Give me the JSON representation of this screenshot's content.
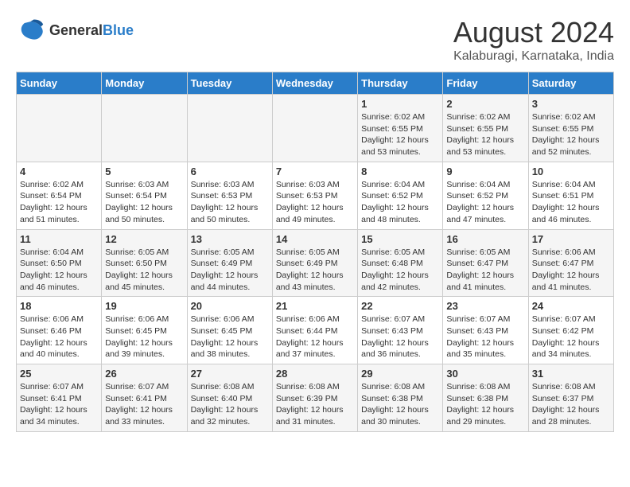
{
  "header": {
    "logo_line1": "General",
    "logo_line2": "Blue",
    "title": "August 2024",
    "subtitle": "Kalaburagi, Karnataka, India"
  },
  "weekdays": [
    "Sunday",
    "Monday",
    "Tuesday",
    "Wednesday",
    "Thursday",
    "Friday",
    "Saturday"
  ],
  "weeks": [
    [
      {
        "day": "",
        "detail": ""
      },
      {
        "day": "",
        "detail": ""
      },
      {
        "day": "",
        "detail": ""
      },
      {
        "day": "",
        "detail": ""
      },
      {
        "day": "1",
        "detail": "Sunrise: 6:02 AM\nSunset: 6:55 PM\nDaylight: 12 hours\nand 53 minutes."
      },
      {
        "day": "2",
        "detail": "Sunrise: 6:02 AM\nSunset: 6:55 PM\nDaylight: 12 hours\nand 53 minutes."
      },
      {
        "day": "3",
        "detail": "Sunrise: 6:02 AM\nSunset: 6:55 PM\nDaylight: 12 hours\nand 52 minutes."
      }
    ],
    [
      {
        "day": "4",
        "detail": "Sunrise: 6:02 AM\nSunset: 6:54 PM\nDaylight: 12 hours\nand 51 minutes."
      },
      {
        "day": "5",
        "detail": "Sunrise: 6:03 AM\nSunset: 6:54 PM\nDaylight: 12 hours\nand 50 minutes."
      },
      {
        "day": "6",
        "detail": "Sunrise: 6:03 AM\nSunset: 6:53 PM\nDaylight: 12 hours\nand 50 minutes."
      },
      {
        "day": "7",
        "detail": "Sunrise: 6:03 AM\nSunset: 6:53 PM\nDaylight: 12 hours\nand 49 minutes."
      },
      {
        "day": "8",
        "detail": "Sunrise: 6:04 AM\nSunset: 6:52 PM\nDaylight: 12 hours\nand 48 minutes."
      },
      {
        "day": "9",
        "detail": "Sunrise: 6:04 AM\nSunset: 6:52 PM\nDaylight: 12 hours\nand 47 minutes."
      },
      {
        "day": "10",
        "detail": "Sunrise: 6:04 AM\nSunset: 6:51 PM\nDaylight: 12 hours\nand 46 minutes."
      }
    ],
    [
      {
        "day": "11",
        "detail": "Sunrise: 6:04 AM\nSunset: 6:50 PM\nDaylight: 12 hours\nand 46 minutes."
      },
      {
        "day": "12",
        "detail": "Sunrise: 6:05 AM\nSunset: 6:50 PM\nDaylight: 12 hours\nand 45 minutes."
      },
      {
        "day": "13",
        "detail": "Sunrise: 6:05 AM\nSunset: 6:49 PM\nDaylight: 12 hours\nand 44 minutes."
      },
      {
        "day": "14",
        "detail": "Sunrise: 6:05 AM\nSunset: 6:49 PM\nDaylight: 12 hours\nand 43 minutes."
      },
      {
        "day": "15",
        "detail": "Sunrise: 6:05 AM\nSunset: 6:48 PM\nDaylight: 12 hours\nand 42 minutes."
      },
      {
        "day": "16",
        "detail": "Sunrise: 6:05 AM\nSunset: 6:47 PM\nDaylight: 12 hours\nand 41 minutes."
      },
      {
        "day": "17",
        "detail": "Sunrise: 6:06 AM\nSunset: 6:47 PM\nDaylight: 12 hours\nand 41 minutes."
      }
    ],
    [
      {
        "day": "18",
        "detail": "Sunrise: 6:06 AM\nSunset: 6:46 PM\nDaylight: 12 hours\nand 40 minutes."
      },
      {
        "day": "19",
        "detail": "Sunrise: 6:06 AM\nSunset: 6:45 PM\nDaylight: 12 hours\nand 39 minutes."
      },
      {
        "day": "20",
        "detail": "Sunrise: 6:06 AM\nSunset: 6:45 PM\nDaylight: 12 hours\nand 38 minutes."
      },
      {
        "day": "21",
        "detail": "Sunrise: 6:06 AM\nSunset: 6:44 PM\nDaylight: 12 hours\nand 37 minutes."
      },
      {
        "day": "22",
        "detail": "Sunrise: 6:07 AM\nSunset: 6:43 PM\nDaylight: 12 hours\nand 36 minutes."
      },
      {
        "day": "23",
        "detail": "Sunrise: 6:07 AM\nSunset: 6:43 PM\nDaylight: 12 hours\nand 35 minutes."
      },
      {
        "day": "24",
        "detail": "Sunrise: 6:07 AM\nSunset: 6:42 PM\nDaylight: 12 hours\nand 34 minutes."
      }
    ],
    [
      {
        "day": "25",
        "detail": "Sunrise: 6:07 AM\nSunset: 6:41 PM\nDaylight: 12 hours\nand 34 minutes."
      },
      {
        "day": "26",
        "detail": "Sunrise: 6:07 AM\nSunset: 6:41 PM\nDaylight: 12 hours\nand 33 minutes."
      },
      {
        "day": "27",
        "detail": "Sunrise: 6:08 AM\nSunset: 6:40 PM\nDaylight: 12 hours\nand 32 minutes."
      },
      {
        "day": "28",
        "detail": "Sunrise: 6:08 AM\nSunset: 6:39 PM\nDaylight: 12 hours\nand 31 minutes."
      },
      {
        "day": "29",
        "detail": "Sunrise: 6:08 AM\nSunset: 6:38 PM\nDaylight: 12 hours\nand 30 minutes."
      },
      {
        "day": "30",
        "detail": "Sunrise: 6:08 AM\nSunset: 6:38 PM\nDaylight: 12 hours\nand 29 minutes."
      },
      {
        "day": "31",
        "detail": "Sunrise: 6:08 AM\nSunset: 6:37 PM\nDaylight: 12 hours\nand 28 minutes."
      }
    ]
  ]
}
